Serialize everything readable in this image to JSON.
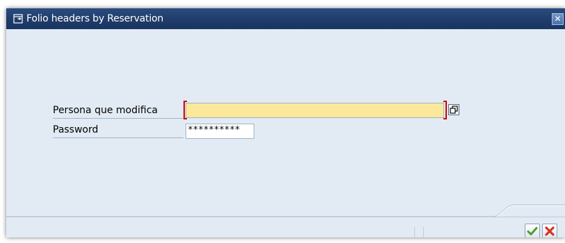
{
  "window": {
    "title": "Folio headers by Reservation",
    "title_icon": "dialog-icon",
    "close_icon": "close-icon",
    "close_symbol": "✕"
  },
  "form": {
    "user_label": "Persona que modifica",
    "user_value": "",
    "user_required": true,
    "user_help_icon": "value-help-icon",
    "password_label": "Password",
    "password_value": "**********"
  },
  "footer": {
    "ok_icon": "checkmark-icon",
    "cancel_icon": "cancel-icon"
  },
  "colors": {
    "titlebar": "#1f3c6a",
    "background": "#e2ebf4",
    "required_field": "#fbe89b",
    "required_marker": "#d00000",
    "ok_green": "#4aa02c",
    "cancel_red": "#d8321e"
  }
}
